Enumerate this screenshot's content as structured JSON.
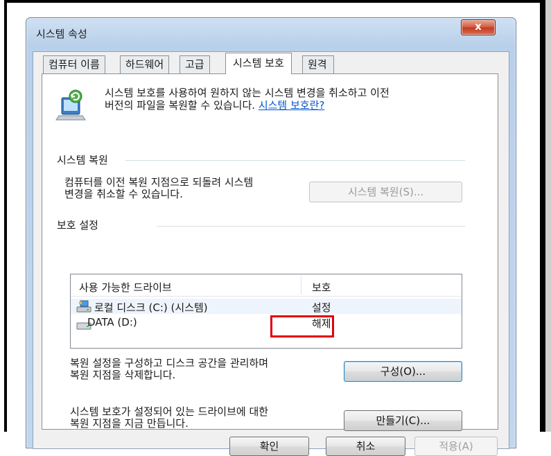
{
  "window": {
    "title": "시스템 속성",
    "close_label": "x"
  },
  "tabs": [
    {
      "label": "컴퓨터 이름"
    },
    {
      "label": "하드웨어"
    },
    {
      "label": "고급"
    },
    {
      "label": "시스템 보호"
    },
    {
      "label": "원격"
    }
  ],
  "intro": {
    "line1": "시스템 보호를 사용하여 원하지 않는 시스템 변경을 취소하고 이전",
    "line2": "버전의 파일을 복원할 수 있습니다. ",
    "link": "시스템 보호란?"
  },
  "system_restore": {
    "group_title": "시스템 복원",
    "desc_line1": "컴퓨터를 이전 복원 지점으로 되돌려 시스템",
    "desc_line2": "변경을 취소할 수 있습니다.",
    "button": "시스템 복원(S)..."
  },
  "protection": {
    "group_title": "보호 설정",
    "columns": [
      "사용 가능한 드라이브",
      "보호"
    ],
    "drives": [
      {
        "name": "로컬 디스크 (C:) (시스템)",
        "status": "설정",
        "icon": "system-drive-icon"
      },
      {
        "name": "DATA (D:)",
        "status": "해제",
        "icon": "hard-drive-icon"
      }
    ],
    "configure_desc_line1": "복원 설정을 구성하고 디스크 공간을 관리하며",
    "configure_desc_line2": "복원 지점을 삭제합니다.",
    "configure_button": "구성(O)...",
    "create_desc_line1": "시스템 보호가 설정되어 있는 드라이브에 대한",
    "create_desc_line2": "복원 지점을 지금 만듭니다.",
    "create_button": "만들기(C)..."
  },
  "footer": {
    "ok": "확인",
    "cancel": "취소",
    "apply": "적용(A)"
  },
  "colors": {
    "highlight": "#e1000f",
    "link": "#0055cc"
  }
}
